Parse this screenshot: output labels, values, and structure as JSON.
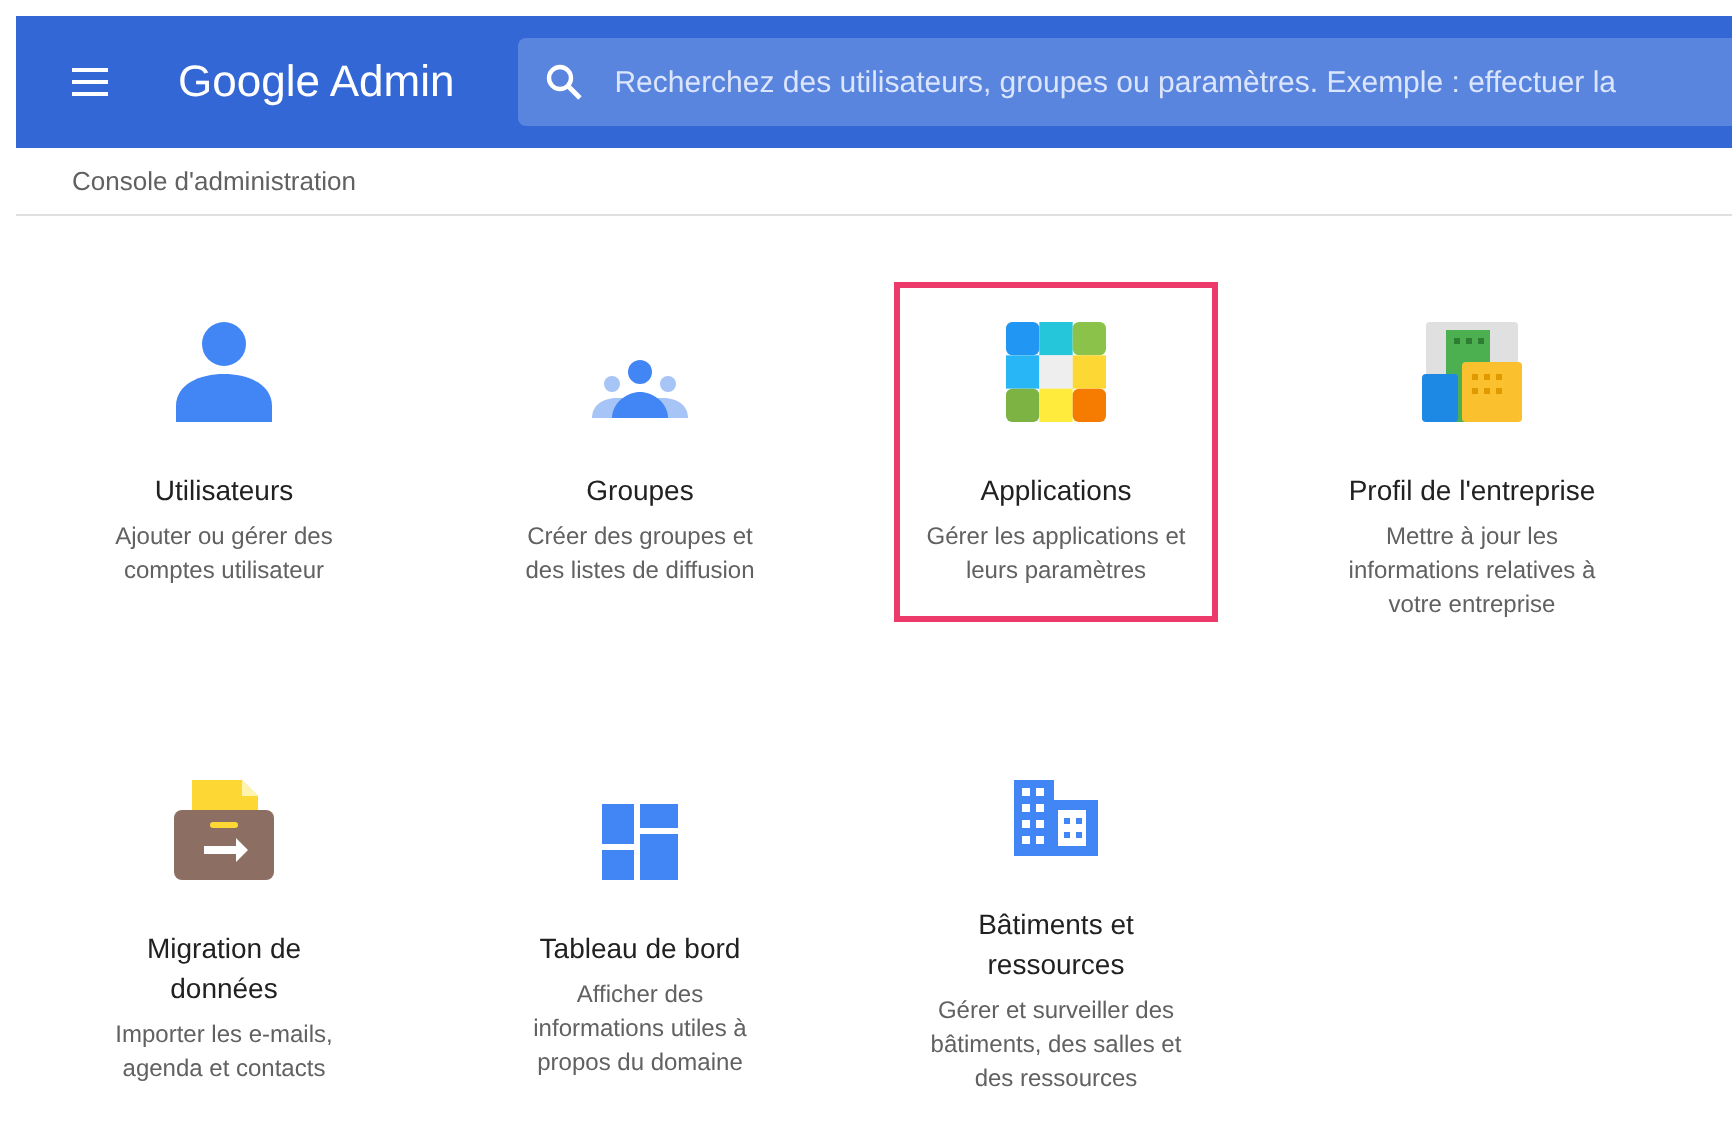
{
  "header": {
    "title": "Google Admin",
    "search": {
      "placeholder": "Recherchez des utilisateurs, groupes ou paramètres. Exemple : effectuer la"
    }
  },
  "breadcrumb": "Console d'administration",
  "tiles": [
    {
      "kind": "users",
      "title": "Utilisateurs",
      "description": "Ajouter ou gérer des\ncomptes utilisateur",
      "highlighted": false
    },
    {
      "kind": "groups",
      "title": "Groupes",
      "description": "Créer des groupes et\ndes listes de diffusion",
      "highlighted": false
    },
    {
      "kind": "apps",
      "title": "Applications",
      "description": "Gérer les applications et\nleurs paramètres",
      "highlighted": true
    },
    {
      "kind": "company",
      "title": "Profil de l'entreprise",
      "description": "Mettre à jour les\ninformations relatives à\nvotre entreprise",
      "highlighted": false
    },
    {
      "kind": "migration",
      "title": "Migration de\ndonnées",
      "description": "Importer les e-mails,\nagenda et contacts",
      "highlighted": false
    },
    {
      "kind": "dashboard",
      "title": "Tableau de bord",
      "description": "Afficher des\ninformations utiles à\npropos du domaine",
      "highlighted": false
    },
    {
      "kind": "buildings",
      "title": "Bâtiments et\nressources",
      "description": "Gérer et surveiller des\nbâtiments, des salles et\ndes ressources",
      "highlighted": false
    }
  ]
}
